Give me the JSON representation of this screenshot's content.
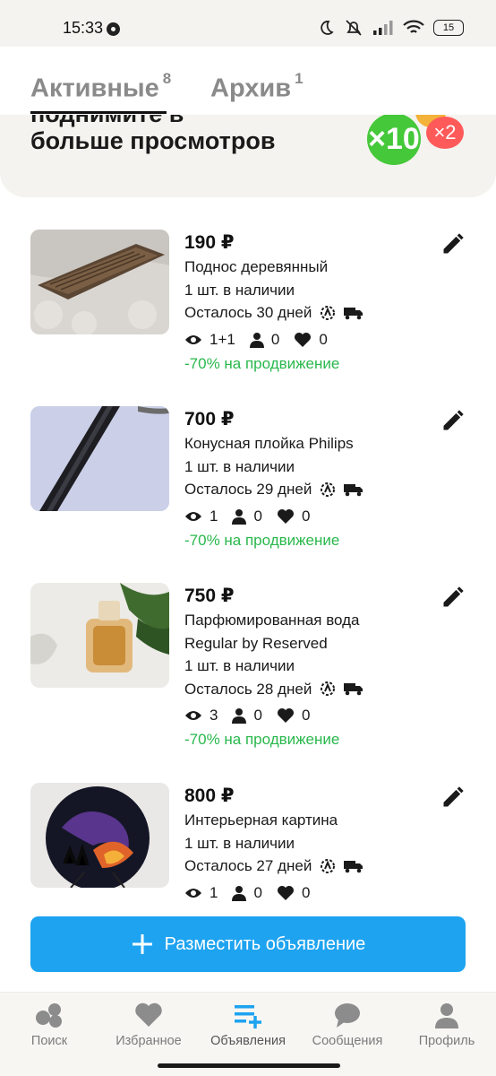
{
  "status_bar": {
    "time": "15:33",
    "battery": "15"
  },
  "tabs": [
    {
      "label": "Активные",
      "count": "8"
    },
    {
      "label": "Архив",
      "count": "1"
    }
  ],
  "banner": {
    "text": "больше просмотров",
    "partial_text": "поднимите в",
    "badge_main": "×10",
    "badge_secondary": "×2"
  },
  "listings": [
    {
      "price": "190 ₽",
      "title": [
        "Поднос деревянный"
      ],
      "stock": "1 шт. в наличии",
      "days_left": "Осталось 30 дней",
      "views": "1+1",
      "contacts": "0",
      "favorites": "0",
      "promo": "-70% на продвижение"
    },
    {
      "price": "700 ₽",
      "title": [
        "Конусная плойка Philips"
      ],
      "stock": "1 шт. в наличии",
      "days_left": "Осталось 29 дней",
      "views": "1",
      "contacts": "0",
      "favorites": "0",
      "promo": "-70% на продвижение"
    },
    {
      "price": "750 ₽",
      "title": [
        "Парфюмированная вода",
        "Regular by Reserved"
      ],
      "stock": "1 шт. в наличии",
      "days_left": "Осталось 28 дней",
      "views": "3",
      "contacts": "0",
      "favorites": "0",
      "promo": "-70% на продвижение"
    },
    {
      "price": "800 ₽",
      "title": [
        "Интерьерная картина"
      ],
      "stock": "1 шт. в наличии",
      "days_left": "Осталось 27 дней",
      "views": "1",
      "contacts": "0",
      "favorites": "0",
      "promo": ""
    }
  ],
  "cta": {
    "label": "Разместить объявление"
  },
  "bottom_nav": [
    {
      "label": "Поиск",
      "icon": "search-icon"
    },
    {
      "label": "Избранное",
      "icon": "heart-icon"
    },
    {
      "label": "Объявления",
      "icon": "listings-add-icon",
      "active": true
    },
    {
      "label": "Сообщения",
      "icon": "chat-icon"
    },
    {
      "label": "Профиль",
      "icon": "profile-icon"
    }
  ],
  "colors": {
    "accent": "#1ea3f0",
    "promo_green": "#29b84c",
    "badge_green": "#45c83a",
    "badge_red": "#ff5a5a",
    "banner_bg": "#f5f3ef"
  }
}
